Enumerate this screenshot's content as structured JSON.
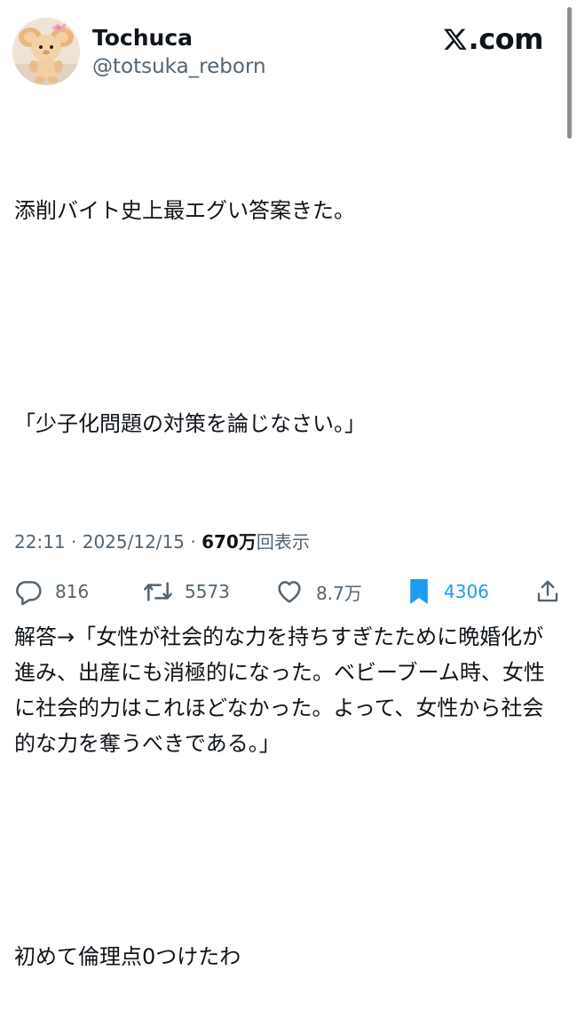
{
  "author": {
    "display_name": "Tochuca",
    "handle": "@totsuka_reborn",
    "avatar_icon": "plush-toy-avatar"
  },
  "brand": {
    "label": ".com"
  },
  "tweet": {
    "paragraphs": [
      "添削バイト史上最エグい答案きた。",
      "「少子化問題の対策を論じなさい。」",
      "解答→「女性が社会的な力を持ちすぎたために晩婚化が進み、出産にも消極的になった。ベビーブーム時、女性に社会的力はこれほどなかった。よって、女性から社会的な力を奪うべきである。」",
      "初めて倫理点0つけたわ"
    ]
  },
  "meta": {
    "time": "22:11",
    "separator": "·",
    "date": "2025/12/15",
    "views_count": "670万",
    "views_label": "回表示"
  },
  "actions": {
    "replies": "816",
    "reposts": "5573",
    "likes": "8.7万",
    "bookmarks": "4306"
  },
  "colors": {
    "text": "#0f1419",
    "secondary": "#536471",
    "accent": "#1d9bf0"
  }
}
